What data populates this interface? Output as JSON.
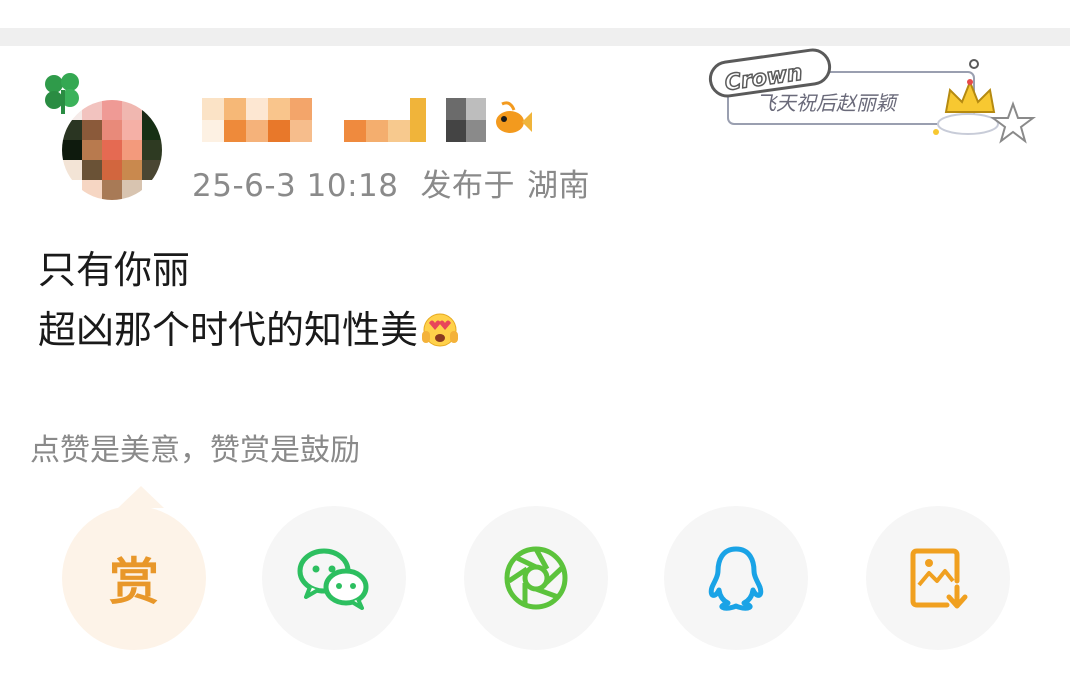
{
  "post": {
    "timestamp": "25-6-3 10:18",
    "location_prefix": "发布于",
    "location": "湖南",
    "content_line1": "只有你丽",
    "content_line2": "超凶那个时代的知性美",
    "content_emoji": "😍"
  },
  "badge": {
    "title": "Crown",
    "subtitle": "飞天祝后赵丽颖"
  },
  "reward": {
    "hint": "点赞是美意，赞赏是鼓励",
    "reward_label": "赏"
  },
  "share": {
    "items": [
      {
        "icon": "reward-icon",
        "color": "#e8972a"
      },
      {
        "icon": "wechat-icon",
        "color": "#2dbf60"
      },
      {
        "icon": "moments-icon",
        "color": "#5cc33c"
      },
      {
        "icon": "qq-icon",
        "color": "#1aa3e6"
      },
      {
        "icon": "save-image-icon",
        "color": "#f0a020"
      }
    ]
  }
}
